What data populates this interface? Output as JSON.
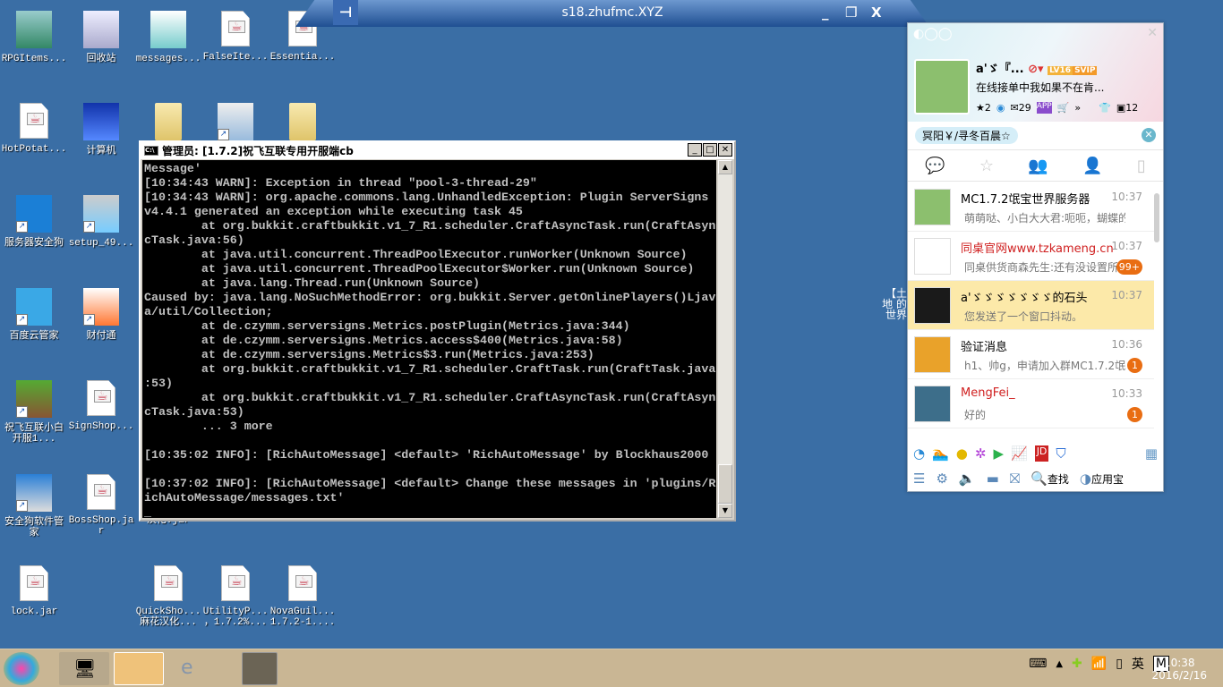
{
  "remote_bar": {
    "title": "s18.zhufmc.XYZ",
    "pin": "⊣",
    "minimize": "_",
    "restore": "❐",
    "close": "X"
  },
  "desktop": {
    "icons": [
      {
        "label": "RPGItems...",
        "type": "image"
      },
      {
        "label": "回收站",
        "type": "recycle-bin"
      },
      {
        "label": "messages...",
        "type": "notepad"
      },
      {
        "label": "FalseIte...",
        "type": "jar"
      },
      {
        "label": "Essentia...",
        "type": "jar"
      },
      {
        "label": "HotPotat...",
        "type": "jar"
      },
      {
        "label": "计算机",
        "type": "computer"
      },
      {
        "label": "",
        "type": "folder"
      },
      {
        "label": "",
        "type": "settings-shortcut"
      },
      {
        "label": "",
        "type": "folder"
      },
      {
        "label": "服务器安全狗",
        "type": "safedog"
      },
      {
        "label": "setup_49...",
        "type": "installer"
      },
      {
        "label": "百度云管家",
        "type": "baidu-cloud"
      },
      {
        "label": "财付通",
        "type": "tenpay"
      },
      {
        "label": "祝飞互联小白开服1...",
        "type": "minecraft"
      },
      {
        "label": "SignShop...",
        "type": "jar"
      },
      {
        "label": "安全狗软件管家",
        "type": "safedog-software"
      },
      {
        "label": "BossShop.jar",
        "type": "jar"
      },
      {
        "label": "汉化.jar",
        "type": "jar"
      },
      {
        "label": "lock.jar",
        "type": "jar"
      },
      {
        "label": "QuickSho... 麻花汉化...",
        "type": "jar"
      },
      {
        "label": "UtilityP... ，1.7.2%...",
        "type": "jar"
      },
      {
        "label": "NovaGuil... 1.7.2-1....",
        "type": "jar"
      }
    ],
    "partial_icon_label": "【土地 的世界"
  },
  "console": {
    "title": "管理员:  [1.7.2]祝飞互联专用开服端cb",
    "lines": [
      "Message'",
      "[10:34:43 WARN]: Exception in thread \"pool-3-thread-29\"",
      "[10:34:43 WARN]: org.apache.commons.lang.UnhandledException: Plugin ServerSigns",
      "v4.4.1 generated an exception while executing task 45",
      "        at org.bukkit.craftbukkit.v1_7_R1.scheduler.CraftAsyncTask.run(CraftAsyn",
      "cTask.java:56)",
      "        at java.util.concurrent.ThreadPoolExecutor.runWorker(Unknown Source)",
      "        at java.util.concurrent.ThreadPoolExecutor$Worker.run(Unknown Source)",
      "        at java.lang.Thread.run(Unknown Source)",
      "Caused by: java.lang.NoSuchMethodError: org.bukkit.Server.getOnlinePlayers()Ljav",
      "a/util/Collection;",
      "        at de.czymm.serversigns.Metrics.postPlugin(Metrics.java:344)",
      "        at de.czymm.serversigns.Metrics.access$400(Metrics.java:58)",
      "        at de.czymm.serversigns.Metrics$3.run(Metrics.java:253)",
      "        at org.bukkit.craftbukkit.v1_7_R1.scheduler.CraftTask.run(CraftTask.java",
      ":53)",
      "        at org.bukkit.craftbukkit.v1_7_R1.scheduler.CraftAsyncTask.run(CraftAsyn",
      "cTask.java:53)",
      "        ... 3 more",
      "",
      "[10:35:02 INFO]: [RichAutoMessage] <default> 'RichAutoMessage' by Blockhaus2000",
      "",
      "[10:37:02 INFO]: [RichAutoMessage] <default> Change these messages in 'plugins/R",
      "ichAutoMessage/messages.txt'",
      "_"
    ]
  },
  "qq": {
    "nickname": "a'ゞ『...",
    "level": "LV16",
    "svip": "SVIP",
    "signature": "在线接单中我如果不在肯...",
    "counts": {
      "likes": "2",
      "mail": "29",
      "skin": "12"
    },
    "tag": "冥阳￥/寻冬百晨☆",
    "conversations": [
      {
        "name": "MC1.7.2氓宝世界服务器",
        "time": "10:37",
        "preview": "萌萌哒、小白大大君:呃呃，蝴蝶的地",
        "badge": null,
        "red": false,
        "selected": false,
        "avatar_color": "#8cbf6e"
      },
      {
        "name": "同桌官网www.tzkameng.cn",
        "time": "10:37",
        "preview": "同桌供货商森先生:还有没设置所",
        "badge": "99+",
        "red": true,
        "selected": false,
        "avatar_color": "#ffffff"
      },
      {
        "name": "a'ゞゞゞゞゞゞゞ的石头",
        "time": "10:37",
        "preview": "您发送了一个窗口抖动。",
        "badge": null,
        "red": false,
        "selected": true,
        "avatar_color": "#1a1a1a"
      },
      {
        "name": "验证消息",
        "time": "10:36",
        "preview": "h1、帅g，申请加入群MC1.7.2氓宝",
        "badge": "1",
        "red": false,
        "selected": false,
        "avatar_color": "#e9a22a"
      },
      {
        "name": "MengFei_",
        "time": "10:33",
        "preview": "好的",
        "badge": "1",
        "red": true,
        "selected": false,
        "avatar_color": "#3d6e8a"
      }
    ],
    "search_label": "查找",
    "appstore_label": "应用宝"
  },
  "taskbar": {
    "time": "10:38",
    "date": "2016/2/16",
    "ime": "英",
    "ime_mode": "M"
  }
}
